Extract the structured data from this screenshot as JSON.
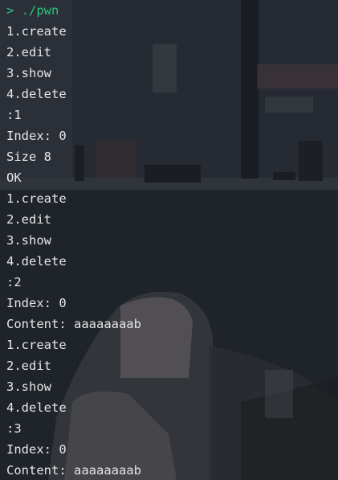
{
  "terminal": {
    "prompt": {
      "symbol": ">",
      "command": "./pwn"
    },
    "lines": [
      "1.create",
      "2.edit",
      "3.show",
      "4.delete",
      ":1",
      "Index: 0",
      "Size 8",
      "OK",
      "1.create",
      "2.edit",
      "3.show",
      "4.delete",
      ":2",
      "Index: 0",
      "Content: aaaaaaaab",
      "1.create",
      "2.edit",
      "3.show",
      "4.delete",
      ":3",
      "Index: 0",
      "Content: aaaaaaaab"
    ]
  },
  "colors": {
    "prompt": "#2ec27e",
    "text": "#e6e6e6",
    "background": "#242932"
  }
}
